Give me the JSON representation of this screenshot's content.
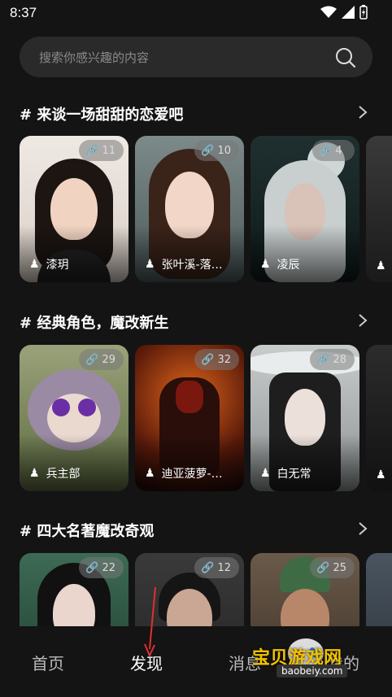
{
  "status": {
    "time": "8:37"
  },
  "search": {
    "placeholder": "搜索你感兴趣的内容"
  },
  "sections": [
    {
      "title": "# 来谈一场甜甜的恋爱吧",
      "cards": [
        {
          "name": "漆玥",
          "count": "11"
        },
        {
          "name": "张叶溪-落…",
          "count": "10"
        },
        {
          "name": "凌辰",
          "count": "4"
        }
      ]
    },
    {
      "title": "# 经典角色，魔改新生",
      "cards": [
        {
          "name": "兵主部",
          "count": "29"
        },
        {
          "name": "迪亚菠萝-…",
          "count": "32"
        },
        {
          "name": "白无常",
          "count": "28"
        }
      ]
    },
    {
      "title": "# 四大名著魔改奇观",
      "cards": [
        {
          "name": "",
          "count": "22"
        },
        {
          "name": "",
          "count": "12"
        },
        {
          "name": "",
          "count": "25"
        }
      ]
    }
  ],
  "tabs": [
    "首页",
    "发现",
    "消息",
    "我的"
  ],
  "watermark": {
    "text": "宝贝游戏网",
    "url": "baobeiy.com"
  },
  "colors": {
    "background": "#141414",
    "search_bg": "#2a2a2a",
    "arrow": "#e03030"
  }
}
